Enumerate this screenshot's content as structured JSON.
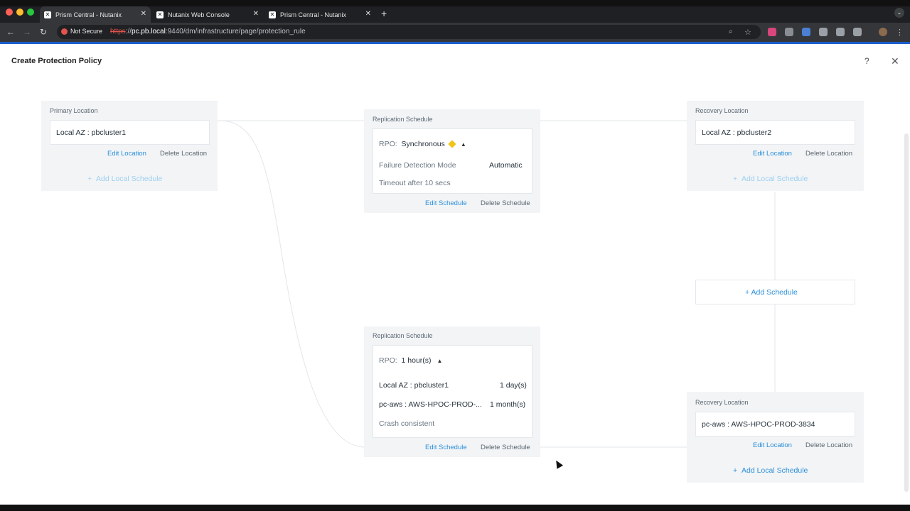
{
  "browser": {
    "tabs": [
      {
        "title": "Prism Central - Nutanix",
        "active": true
      },
      {
        "title": "Nutanix Web Console",
        "active": false
      },
      {
        "title": "Prism Central - Nutanix",
        "active": false
      }
    ],
    "security_label": "Not Secure",
    "url_proto": "https",
    "url_host": "pc.pb.local",
    "url_path": ":9440/dm/infrastructure/page/protection_rule"
  },
  "dialog": {
    "title": "Create Protection Policy",
    "help_icon": "?",
    "close_icon": "✕"
  },
  "primary_location": {
    "label": "Primary Location",
    "value": "Local AZ : pbcluster1",
    "edit_link": "Edit Location",
    "delete_link": "Delete Location",
    "add_schedule": "Add Local Schedule"
  },
  "schedule_sync": {
    "label": "Replication Schedule",
    "rpo_label": "RPO:",
    "rpo_value": "Synchronous",
    "failure_mode_label": "Failure Detection Mode",
    "failure_mode_value": "Automatic",
    "timeout": "Timeout after 10 secs",
    "edit_link": "Edit Schedule",
    "delete_link": "Delete Schedule"
  },
  "recovery_1": {
    "label": "Recovery Location",
    "value": "Local AZ : pbcluster2",
    "edit_link": "Edit Location",
    "delete_link": "Delete Location",
    "add_schedule": "Add Local Schedule"
  },
  "add_schedule_button": "Add Schedule",
  "schedule_hourly": {
    "label": "Replication Schedule",
    "rpo_label": "RPO:",
    "rpo_value": "1 hour(s)",
    "rows": [
      {
        "name": "Local AZ : pbcluster1",
        "retention": "1 day(s)"
      },
      {
        "name": "pc-aws : AWS-HPOC-PROD-...",
        "retention": "1 month(s)"
      }
    ],
    "consistency": "Crash consistent",
    "edit_link": "Edit Schedule",
    "delete_link": "Delete Schedule"
  },
  "recovery_2": {
    "label": "Recovery Location",
    "value": "pc-aws : AWS-HPOC-PROD-3834",
    "edit_link": "Edit Location",
    "delete_link": "Delete Location",
    "add_schedule": "Add Local Schedule"
  }
}
